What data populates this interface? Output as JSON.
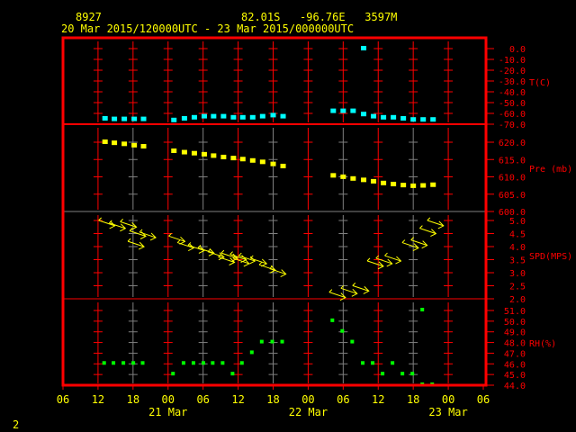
{
  "header": {
    "station": "8927",
    "location": "82.01S   -96.76E   3597M",
    "time_range": "20 Mar 2015/120000UTC - 23 Mar 2015/000000UTC"
  },
  "footer": {
    "page": "2"
  },
  "colors": {
    "frame": "#ff0000",
    "text": "#ffff00",
    "temp": "#00ffff",
    "pres": "#ffff00",
    "wind": "#ffff00",
    "rh": "#00ff00",
    "grid_alt": "#808080"
  },
  "chart_data": {
    "type": "scatter",
    "x_unit": "hours since 20 Mar 06 UTC",
    "xlim": [
      0,
      72
    ],
    "x_ticks": [
      "06",
      "12",
      "18",
      "00",
      "06",
      "12",
      "18",
      "00",
      "06",
      "12",
      "18",
      "00",
      "06"
    ],
    "date_labels": [
      {
        "hour": 18,
        "label": "21 Mar"
      },
      {
        "hour": 42,
        "label": "22 Mar"
      },
      {
        "hour": 66,
        "label": "23 Mar"
      }
    ],
    "panels": [
      {
        "name": "T(C)",
        "ylim": [
          -70,
          0
        ],
        "ticks": [
          "0.0",
          "-10.0",
          "-20.0",
          "-30.0",
          "-40.0",
          "-50.0",
          "-60.0",
          "-70.0"
        ],
        "points": [
          [
            7.2,
            -65
          ],
          [
            8.8,
            -65.5
          ],
          [
            10.5,
            -65.5
          ],
          [
            12.2,
            -65.5
          ],
          [
            13.8,
            -65.5
          ],
          [
            19,
            -66.5
          ],
          [
            20.8,
            -65
          ],
          [
            22.5,
            -64
          ],
          [
            24.2,
            -63
          ],
          [
            25.8,
            -63
          ],
          [
            27.5,
            -63
          ],
          [
            29.2,
            -64
          ],
          [
            30.8,
            -64
          ],
          [
            32.5,
            -64
          ],
          [
            34.2,
            -63
          ],
          [
            36,
            -62
          ],
          [
            37.7,
            -63
          ],
          [
            46.3,
            -58
          ],
          [
            48,
            -58
          ],
          [
            49.7,
            -58
          ],
          [
            51.5,
            -61
          ],
          [
            53.2,
            -63
          ],
          [
            54.9,
            -64
          ],
          [
            56.6,
            -64
          ],
          [
            58.3,
            -65
          ],
          [
            60,
            -66
          ],
          [
            61.7,
            -66
          ],
          [
            63.4,
            -66
          ],
          [
            51.5,
            0
          ]
        ]
      },
      {
        "name": "Pre (mb)",
        "ylim": [
          600,
          620
        ],
        "ticks": [
          "620.0",
          "615.0",
          "610.0",
          "605.0",
          "600.0"
        ],
        "points": [
          [
            7.2,
            620
          ],
          [
            8.8,
            619.7
          ],
          [
            10.5,
            619.4
          ],
          [
            12.2,
            619
          ],
          [
            13.8,
            618.7
          ],
          [
            19,
            617.4
          ],
          [
            20.8,
            617
          ],
          [
            22.5,
            616.7
          ],
          [
            24.2,
            616.4
          ],
          [
            25.8,
            616
          ],
          [
            27.5,
            615.6
          ],
          [
            29.2,
            615.3
          ],
          [
            30.8,
            615
          ],
          [
            32.5,
            614.6
          ],
          [
            34.2,
            614.2
          ],
          [
            36,
            613.6
          ],
          [
            37.7,
            613
          ],
          [
            46.3,
            610.3
          ],
          [
            48,
            609.9
          ],
          [
            49.7,
            609.4
          ],
          [
            51.5,
            609
          ],
          [
            53.2,
            608.6
          ],
          [
            54.9,
            608.1
          ],
          [
            56.6,
            607.8
          ],
          [
            58.3,
            607.5
          ],
          [
            60,
            607.3
          ],
          [
            61.7,
            607.4
          ],
          [
            63.4,
            607.6
          ]
        ]
      },
      {
        "name": "SPD(MPS)",
        "ylim": [
          2,
          5
        ],
        "ticks": [
          "5.0",
          "4.5",
          "4.0",
          "3.5",
          "3.0",
          "2.5",
          "2.0"
        ],
        "points": [
          [
            7.5,
            4.9
          ],
          [
            9.3,
            4.8
          ],
          [
            11.2,
            4.85
          ],
          [
            12.8,
            4.5
          ],
          [
            14.5,
            4.45
          ],
          [
            12.5,
            4.1
          ],
          [
            19.5,
            4.3
          ],
          [
            21,
            4.05
          ],
          [
            22.8,
            3.95
          ],
          [
            24.5,
            3.85
          ],
          [
            26.2,
            3.7
          ],
          [
            28.5,
            3.65
          ],
          [
            30,
            3.6
          ],
          [
            31.5,
            3.55
          ],
          [
            33.5,
            3.45
          ],
          [
            35,
            3.2
          ],
          [
            36.8,
            3.05
          ],
          [
            28,
            3.5
          ],
          [
            30.5,
            3.45
          ],
          [
            47,
            2.15
          ],
          [
            49,
            2.3
          ],
          [
            51,
            2.4
          ],
          [
            53.5,
            3.35
          ],
          [
            55,
            3.45
          ],
          [
            56.5,
            3.55
          ],
          [
            59.5,
            4.05
          ],
          [
            61,
            4.15
          ],
          [
            62.5,
            4.6
          ],
          [
            63.8,
            4.9
          ]
        ]
      },
      {
        "name": "RH(%)",
        "ylim": [
          44,
          51
        ],
        "ticks": [
          "51.0",
          "50.0",
          "49.0",
          "48.0",
          "47.0",
          "46.0",
          "45.0",
          "44.0"
        ],
        "points": [
          [
            7.2,
            46
          ],
          [
            8.8,
            46
          ],
          [
            10.5,
            46
          ],
          [
            12.2,
            46
          ],
          [
            13.8,
            46
          ],
          [
            19,
            45
          ],
          [
            20.8,
            46
          ],
          [
            22.5,
            46
          ],
          [
            24.2,
            46
          ],
          [
            25.8,
            46
          ],
          [
            27.5,
            46
          ],
          [
            29.2,
            45
          ],
          [
            30.8,
            46
          ],
          [
            32.5,
            47
          ],
          [
            34.2,
            48
          ],
          [
            36,
            48
          ],
          [
            37.7,
            48
          ],
          [
            46.3,
            50
          ],
          [
            48,
            49
          ],
          [
            49.7,
            48
          ],
          [
            51.5,
            46
          ],
          [
            53.2,
            46
          ],
          [
            54.9,
            45
          ],
          [
            56.6,
            46
          ],
          [
            58.3,
            45
          ],
          [
            60,
            45
          ],
          [
            61.7,
            44
          ],
          [
            61.7,
            51
          ],
          [
            63.4,
            44
          ]
        ]
      }
    ]
  }
}
